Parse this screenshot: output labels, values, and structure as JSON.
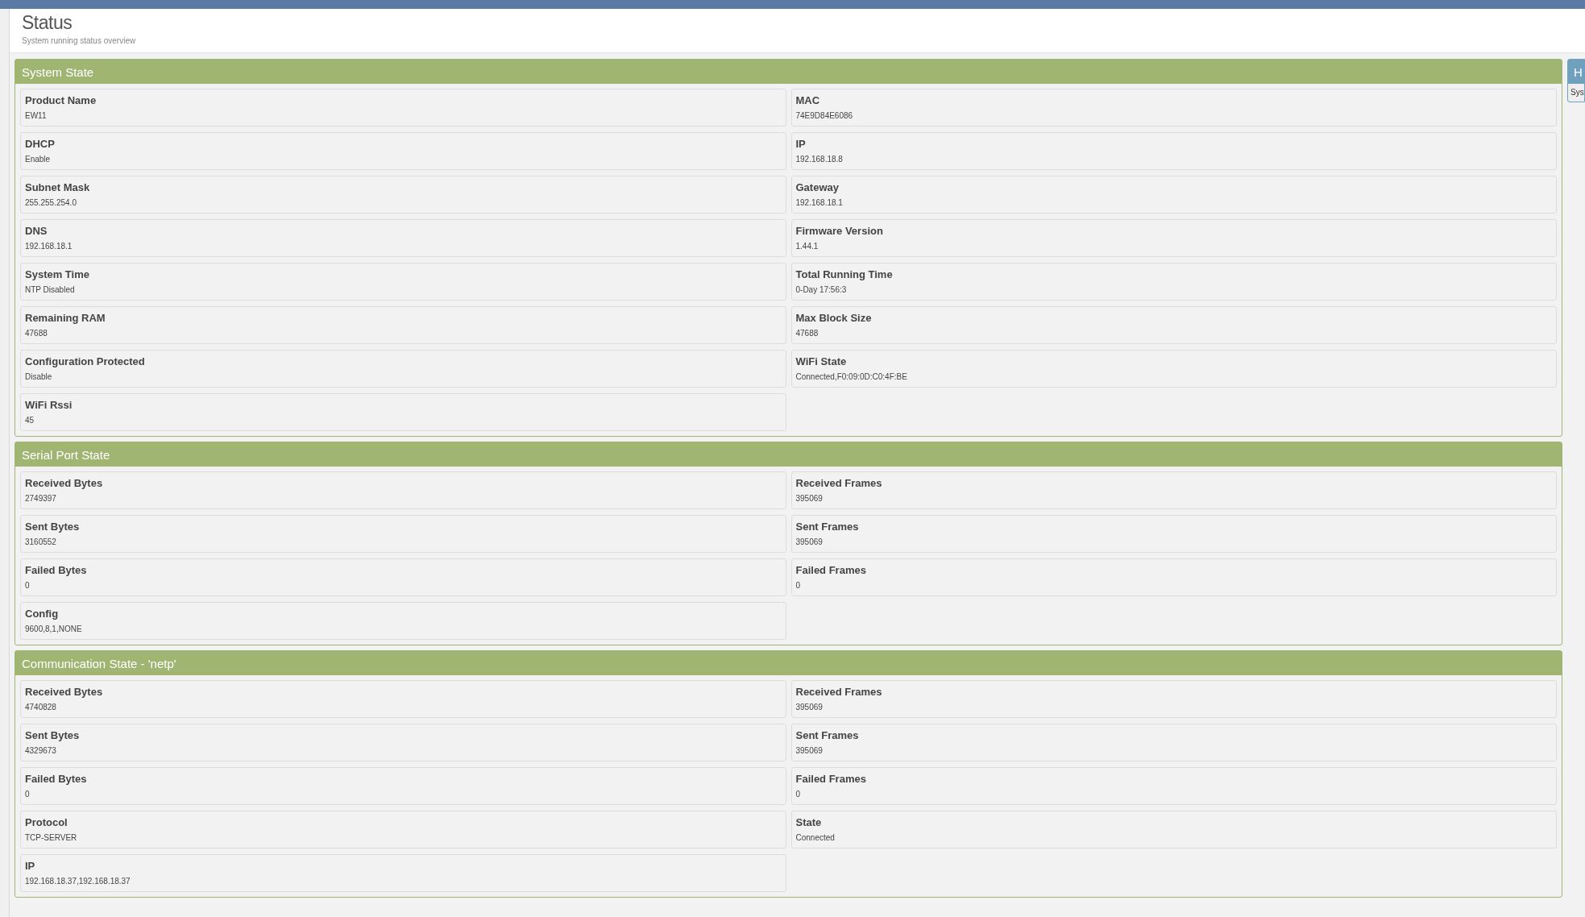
{
  "header": {
    "title": "Status",
    "subtitle": "System running status overview"
  },
  "panels": [
    {
      "title": "System State",
      "items": [
        {
          "label": "Product Name",
          "value": "EW11"
        },
        {
          "label": "MAC",
          "value": "74E9D84E6086"
        },
        {
          "label": "DHCP",
          "value": "Enable"
        },
        {
          "label": "IP",
          "value": "192.168.18.8"
        },
        {
          "label": "Subnet Mask",
          "value": "255.255.254.0"
        },
        {
          "label": "Gateway",
          "value": "192.168.18.1"
        },
        {
          "label": "DNS",
          "value": "192.168.18.1"
        },
        {
          "label": "Firmware Version",
          "value": "1.44.1"
        },
        {
          "label": "System Time",
          "value": "NTP Disabled"
        },
        {
          "label": "Total Running Time",
          "value": "0-Day 17:56:3"
        },
        {
          "label": "Remaining RAM",
          "value": "47688"
        },
        {
          "label": "Max Block Size",
          "value": "47688"
        },
        {
          "label": "Configuration Protected",
          "value": "Disable"
        },
        {
          "label": "WiFi State",
          "value": "Connected,F0:09:0D:C0:4F:BE"
        },
        {
          "label": "WiFi Rssi",
          "value": "45"
        }
      ]
    },
    {
      "title": "Serial Port State",
      "items": [
        {
          "label": "Received Bytes",
          "value": "2749397"
        },
        {
          "label": "Received Frames",
          "value": "395069"
        },
        {
          "label": "Sent Bytes",
          "value": "3160552"
        },
        {
          "label": "Sent Frames",
          "value": "395069"
        },
        {
          "label": "Failed Bytes",
          "value": "0"
        },
        {
          "label": "Failed Frames",
          "value": "0"
        },
        {
          "label": "Config",
          "value": "9600,8,1,NONE"
        }
      ]
    },
    {
      "title": "Communication State - 'netp'",
      "items": [
        {
          "label": "Received Bytes",
          "value": "4740828"
        },
        {
          "label": "Received Frames",
          "value": "395069"
        },
        {
          "label": "Sent Bytes",
          "value": "4329673"
        },
        {
          "label": "Sent Frames",
          "value": "395069"
        },
        {
          "label": "Failed Bytes",
          "value": "0"
        },
        {
          "label": "Failed Frames",
          "value": "0"
        },
        {
          "label": "Protocol",
          "value": "TCP-SERVER"
        },
        {
          "label": "State",
          "value": "Connected"
        },
        {
          "label": "IP",
          "value": "192.168.18.37,192.168.18.37"
        }
      ]
    }
  ],
  "side_panel": {
    "title": "H",
    "text": "Sys"
  }
}
